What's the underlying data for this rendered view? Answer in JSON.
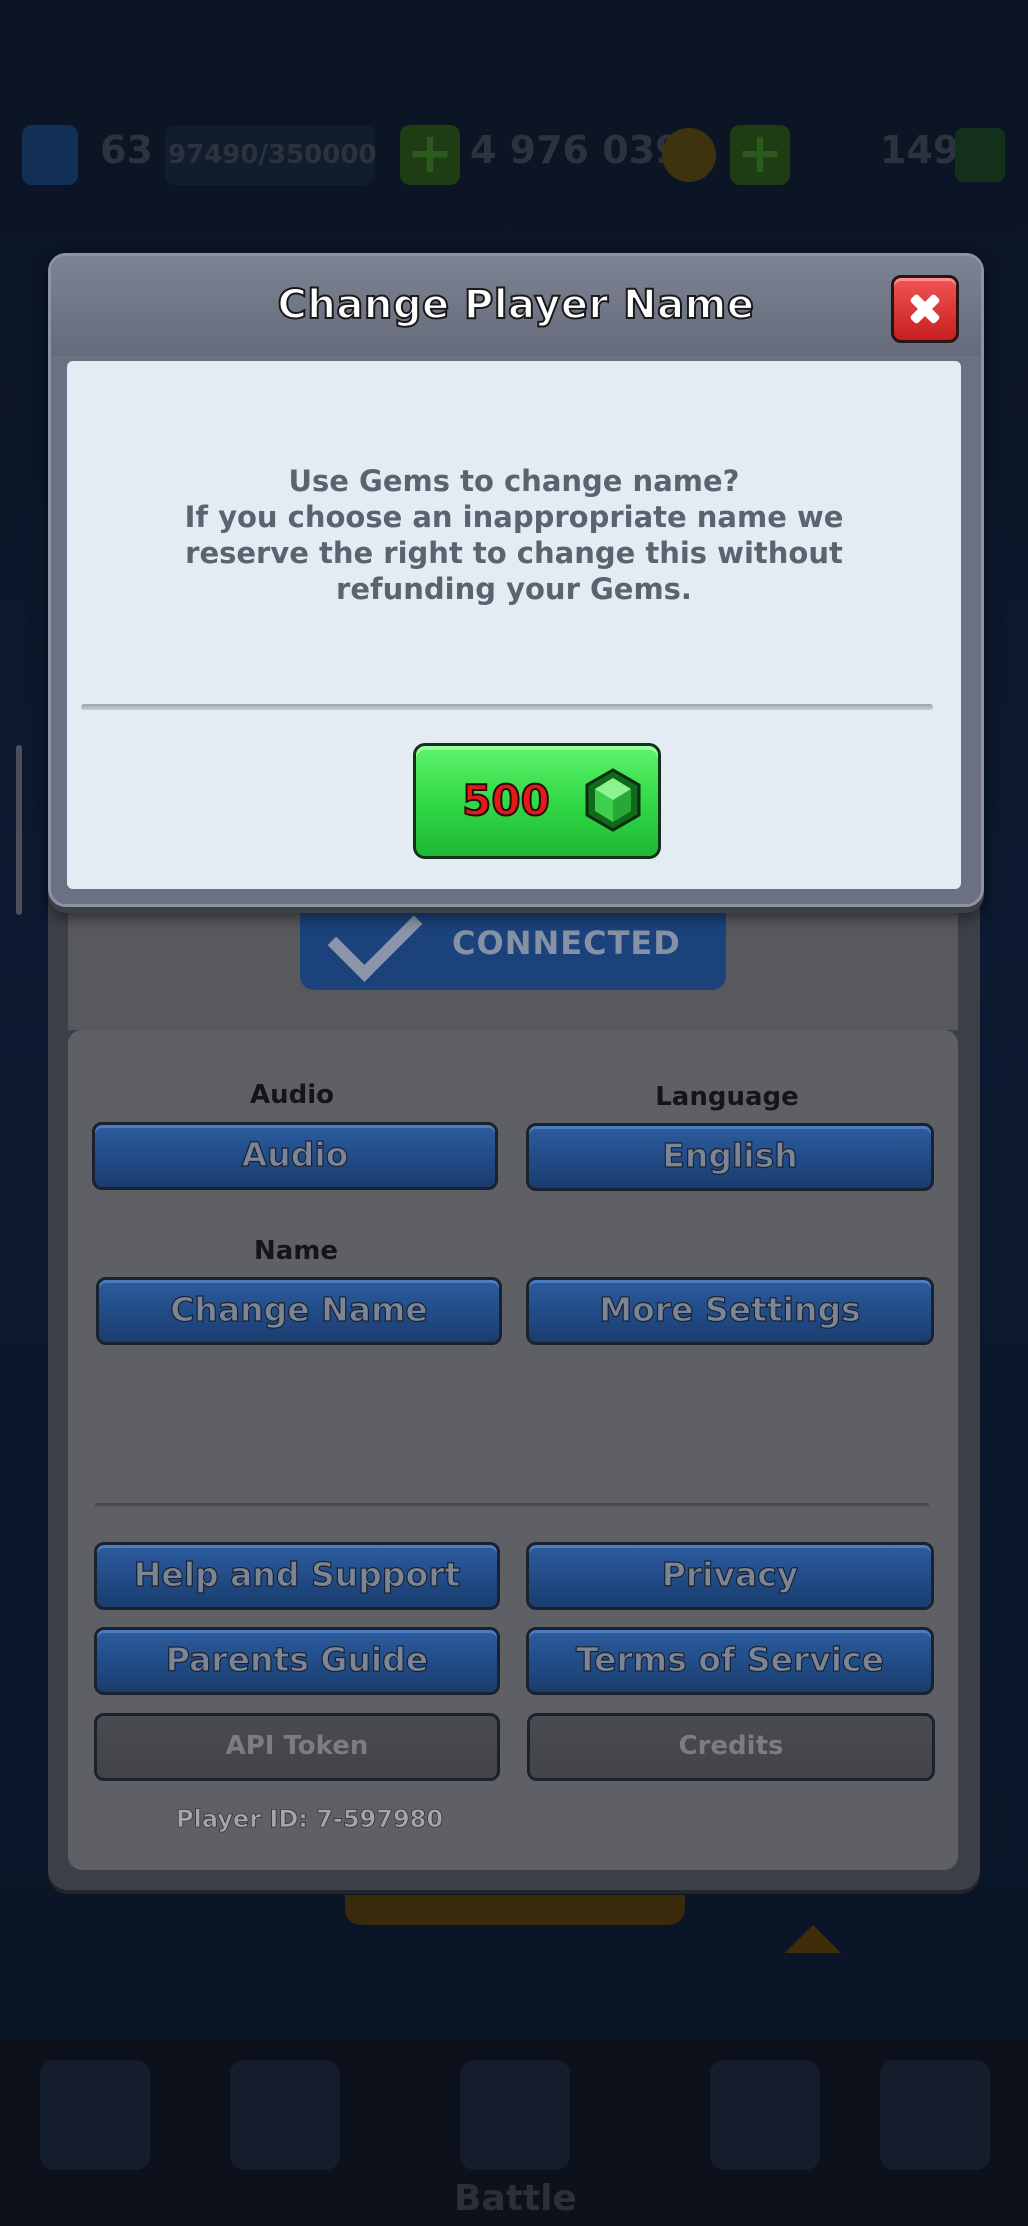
{
  "background": {
    "top_bar": {
      "level": "63",
      "xp_progress": "97490/350000",
      "gold": "4 976 039",
      "gems": "149"
    },
    "bottom_nav": {
      "battle_label": "Battle"
    }
  },
  "settings": {
    "connected_label": "CONNECTED",
    "audio": {
      "label": "Audio",
      "button": "Audio"
    },
    "language": {
      "label": "Language",
      "button": "English"
    },
    "name": {
      "label": "Name",
      "button": "Change Name"
    },
    "more_settings_button": "More Settings",
    "help_button": "Help and Support",
    "privacy_button": "Privacy",
    "parents_guide_button": "Parents Guide",
    "terms_button": "Terms of Service",
    "api_token_button": "API Token",
    "credits_button": "Credits",
    "player_id": "Player ID: 7-597980"
  },
  "modal": {
    "title": "Change Player Name",
    "message": "Use Gems to change name?\nIf you choose an inappropriate name we\nreserve the right to change this without\nrefunding your Gems.",
    "price": "500",
    "colors": {
      "buy": "#2fd744",
      "close": "#e03a3a",
      "price_text": "#e31a1a"
    }
  }
}
